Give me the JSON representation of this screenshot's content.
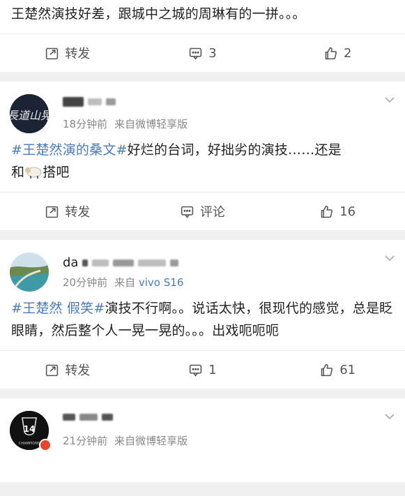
{
  "posts": [
    {
      "text_plain": "王楚然演技好差，跟城中之城的周琳有的一拼。。。",
      "actions": {
        "repost": "转发",
        "comment": "3",
        "like": "2"
      }
    },
    {
      "username_visible": "",
      "time": "18分钟前",
      "source": "来自微博轻享版",
      "hashtag": "#王楚然演的桑文#",
      "text_a": "好烂的台词，好拙劣的演技……还是",
      "text_b_pre": "和",
      "text_b_post": "搭吧",
      "actions": {
        "repost": "转发",
        "comment": "评论",
        "like": "16"
      },
      "avatar_text": "長道山晃"
    },
    {
      "username_visible": "da",
      "time": "20分钟前",
      "source_prefix": "来自",
      "source_device": "vivo S16",
      "hashtag": "#王楚然 假笑#",
      "text": "演技不行啊。。说话太快，很现代的感觉，总是眨眼睛，然后整个人一晃一晃的。。。出戏呃呃呃",
      "actions": {
        "repost": "转发",
        "comment": "1",
        "like": "61"
      }
    },
    {
      "username_visible": "",
      "time": "21分钟前",
      "source": "来自微博轻享版",
      "avatar_text": "14",
      "avatar_sub": "CHAMPIONS"
    }
  ],
  "colors": {
    "link": "#4a7bb8",
    "meta": "#888888",
    "badge": "#e8452c"
  }
}
